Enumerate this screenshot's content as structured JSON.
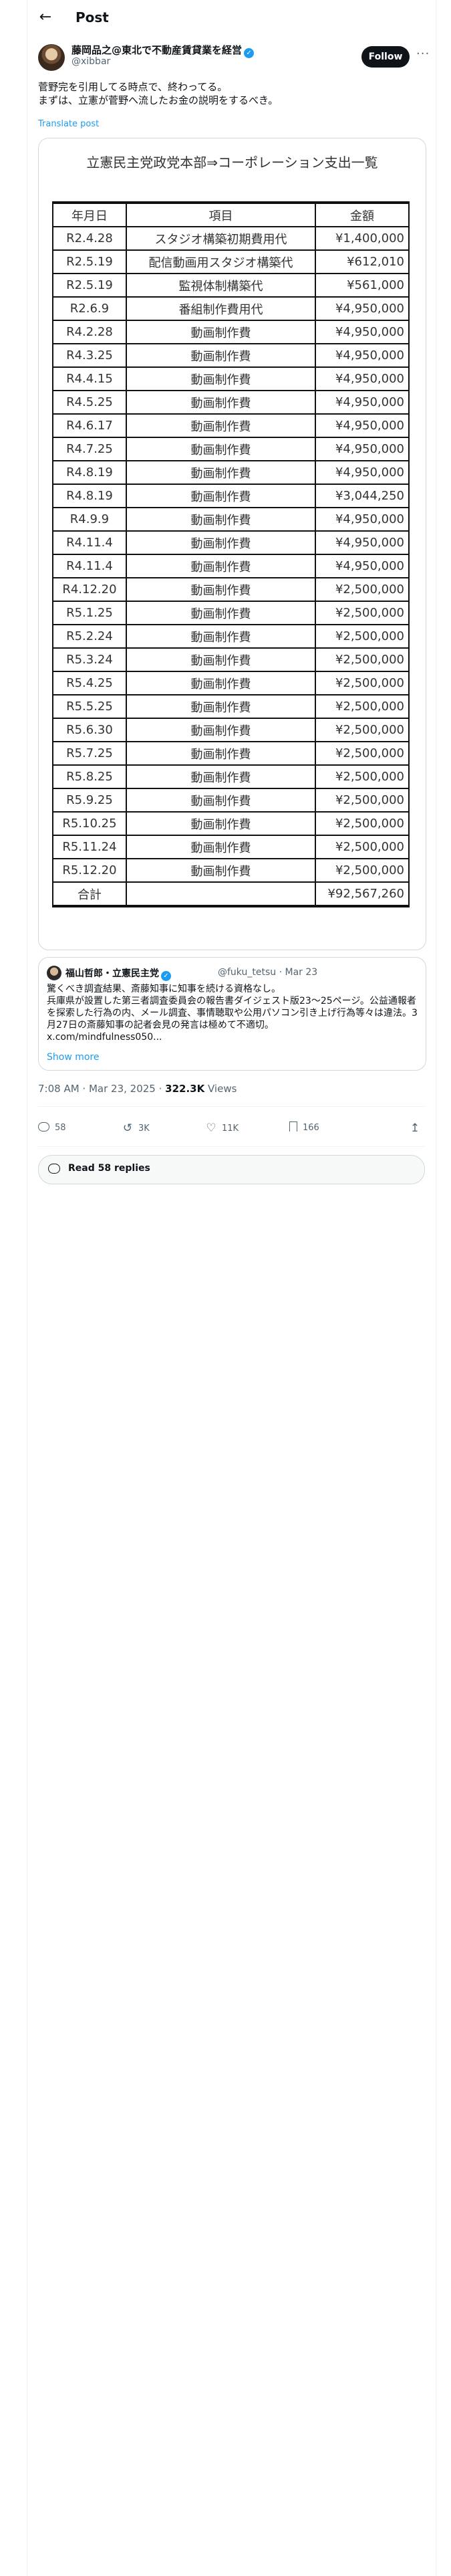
{
  "header": {
    "title": "Post"
  },
  "author": {
    "name": "藤岡品之@東北で不動産賃貸業を経営",
    "handle": "@xibbar",
    "follow_label": "Follow"
  },
  "post": {
    "text": "菅野完を引用してる時点で、終わってる。\nまずは、立憲が菅野へ流したお金の説明をするべき。",
    "translate_label": "Translate post"
  },
  "media": {
    "title": "立憲民主党政党本部⇒コーポレーション支出一覧",
    "columns": [
      "年月日",
      "項目",
      "金額"
    ],
    "rows": [
      [
        "R2.4.28",
        "スタジオ構築初期費用代",
        "¥1,400,000"
      ],
      [
        "R2.5.19",
        "配信動画用スタジオ構築代",
        "¥612,010"
      ],
      [
        "R2.5.19",
        "監視体制構築代",
        "¥561,000"
      ],
      [
        "R2.6.9",
        "番組制作費用代",
        "¥4,950,000"
      ],
      [
        "R4.2.28",
        "動画制作費",
        "¥4,950,000"
      ],
      [
        "R4.3.25",
        "動画制作費",
        "¥4,950,000"
      ],
      [
        "R4.4.15",
        "動画制作費",
        "¥4,950,000"
      ],
      [
        "R4.5.25",
        "動画制作費",
        "¥4,950,000"
      ],
      [
        "R4.6.17",
        "動画制作費",
        "¥4,950,000"
      ],
      [
        "R4.7.25",
        "動画制作費",
        "¥4,950,000"
      ],
      [
        "R4.8.19",
        "動画制作費",
        "¥4,950,000"
      ],
      [
        "R4.8.19",
        "動画制作費",
        "¥3,044,250"
      ],
      [
        "R4.9.9",
        "動画制作費",
        "¥4,950,000"
      ],
      [
        "R4.11.4",
        "動画制作費",
        "¥4,950,000"
      ],
      [
        "R4.11.4",
        "動画制作費",
        "¥4,950,000"
      ],
      [
        "R4.12.20",
        "動画制作費",
        "¥2,500,000"
      ],
      [
        "R5.1.25",
        "動画制作費",
        "¥2,500,000"
      ],
      [
        "R5.2.24",
        "動画制作費",
        "¥2,500,000"
      ],
      [
        "R5.3.24",
        "動画制作費",
        "¥2,500,000"
      ],
      [
        "R5.4.25",
        "動画制作費",
        "¥2,500,000"
      ],
      [
        "R5.5.25",
        "動画制作費",
        "¥2,500,000"
      ],
      [
        "R5.6.30",
        "動画制作費",
        "¥2,500,000"
      ],
      [
        "R5.7.25",
        "動画制作費",
        "¥2,500,000"
      ],
      [
        "R5.8.25",
        "動画制作費",
        "¥2,500,000"
      ],
      [
        "R5.9.25",
        "動画制作費",
        "¥2,500,000"
      ],
      [
        "R5.10.25",
        "動画制作費",
        "¥2,500,000"
      ],
      [
        "R5.11.24",
        "動画制作費",
        "¥2,500,000"
      ],
      [
        "R5.12.20",
        "動画制作費",
        "¥2,500,000"
      ]
    ],
    "total": {
      "label": "合計",
      "amount": "¥92,567,260"
    }
  },
  "quote": {
    "name": "福山哲郎・立憲民主党",
    "handle": "@fuku_tetsu",
    "date": "Mar 23",
    "text": "驚くべき調査結果、斎藤知事に知事を続ける資格なし。\n兵庫県が設置した第三者調査委員会の報告書ダイジェスト版23〜25ページ。公益通報者を探索した行為の内、メール調査、事情聴取や公用パソコン引き上げ行為等々は違法。3月27日の斎藤知事の記者会見の発言は極めて不適切。\nx.com/mindfulness050...",
    "show_more": "Show more"
  },
  "meta": {
    "time": "7:08 AM · Mar 23, 2025 · ",
    "views": "322.3K",
    "views_label": " Views"
  },
  "actions": {
    "replies": "58",
    "reposts": "3K",
    "likes": "11K",
    "bookmarks": "166"
  },
  "read_replies": "Read 58 replies"
}
